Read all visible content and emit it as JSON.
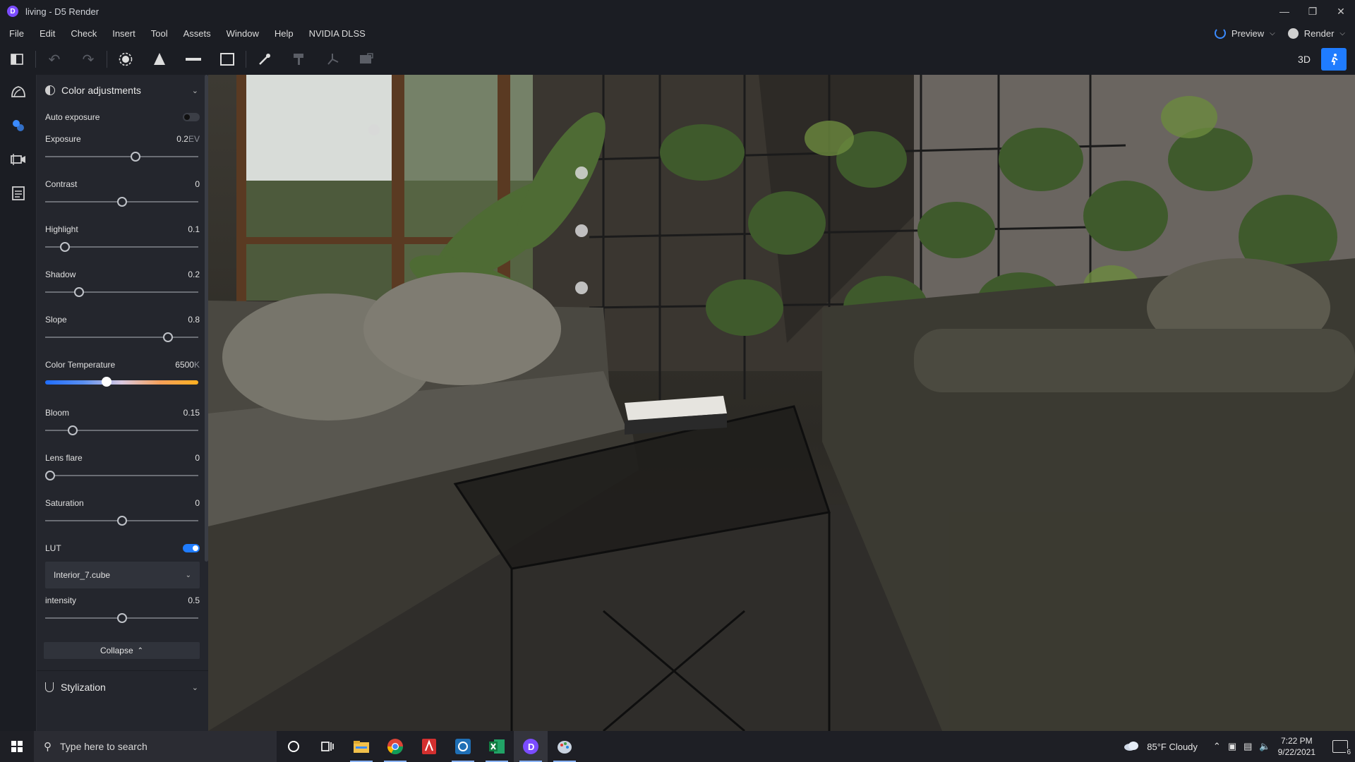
{
  "window": {
    "title": "living - D5 Render",
    "logo_letter": "D"
  },
  "menu": {
    "items": [
      "File",
      "Edit",
      "Check",
      "Insert",
      "Tool",
      "Assets",
      "Window",
      "Help",
      "NVIDIA DLSS"
    ],
    "preview_label": "Preview",
    "render_label": "Render"
  },
  "toolbar": {
    "tools": [
      "panel-toggle-icon",
      "undo-icon",
      "redo-icon",
      "sun-icon",
      "cone-light-icon",
      "strip-light-icon",
      "rect-light-icon",
      "eyedropper-icon",
      "paint-brush-icon",
      "transform-icon",
      "area-select-icon"
    ],
    "mode_3d_label": "3D",
    "accent": "#1f7cff"
  },
  "rail": {
    "items": [
      "environment-icon",
      "color-adjust-icon",
      "camera-icon",
      "list-icon"
    ]
  },
  "panel": {
    "section_title": "Color adjustments",
    "auto_exposure_label": "Auto exposure",
    "auto_exposure_on": false,
    "sliders": [
      {
        "label": "Exposure",
        "value": "0.2",
        "unit": "EV",
        "level": 0.59
      },
      {
        "label": "Contrast",
        "value": "0",
        "unit": "",
        "level": 0.5
      },
      {
        "label": "Highlight",
        "value": "0.1",
        "unit": "",
        "level": 0.13
      },
      {
        "label": "Shadow",
        "value": "0.2",
        "unit": "",
        "level": 0.22
      },
      {
        "label": "Slope",
        "value": "0.8",
        "unit": "",
        "level": 0.8
      }
    ],
    "color_temperature": {
      "label": "Color Temperature",
      "value": "6500",
      "unit": "K",
      "level": 0.4
    },
    "sliders2": [
      {
        "label": "Bloom",
        "value": "0.15",
        "unit": "",
        "level": 0.18
      },
      {
        "label": "Lens flare",
        "value": "0",
        "unit": "",
        "level": 0.03
      },
      {
        "label": "Saturation",
        "value": "0",
        "unit": "",
        "level": 0.5
      }
    ],
    "lut_label": "LUT",
    "lut_on": true,
    "lut_file": "Interior_7.cube",
    "intensity": {
      "label": "intensity",
      "value": "0.5",
      "unit": "",
      "level": 0.5
    },
    "collapse_label": "Collapse",
    "stylization_label": "Stylization"
  },
  "taskbar": {
    "search_placeholder": "Type here to search",
    "apps": [
      "cortana-icon",
      "task-view-icon",
      "file-explorer-icon",
      "chrome-icon",
      "acrobat-icon",
      "sketchup-icon",
      "excel-icon",
      "d5-render-icon",
      "paint-icon"
    ],
    "weather": "85°F  Cloudy",
    "time": "7:22 PM",
    "date": "9/22/2021",
    "notification_count": "6"
  }
}
